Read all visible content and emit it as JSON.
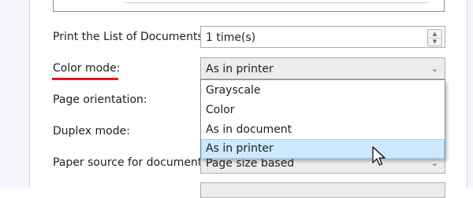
{
  "form": {
    "print_list_label": "Print the List of Documents:",
    "print_list_value": "1 time(s)",
    "color_mode_label": "Color mode:",
    "color_mode_value": "As in printer",
    "page_orientation_label": "Page orientation:",
    "duplex_mode_label": "Duplex mode:",
    "paper_source_label": "Paper source for document:",
    "paper_source_value": "Page size based"
  },
  "dropdown": {
    "options": [
      "Grayscale",
      "Color",
      "As in document",
      "As in printer"
    ],
    "selected_index": 3
  },
  "colors": {
    "accent_underline": "#e2171e",
    "selected_bg": "#cde8ff",
    "selected_border": "#99d1ff"
  },
  "icons": {
    "spinner_up": "triangle-up-icon",
    "spinner_down": "triangle-down-icon",
    "combo_arrow": "chevron-down-icon",
    "pointer": "mouse-cursor-icon"
  }
}
